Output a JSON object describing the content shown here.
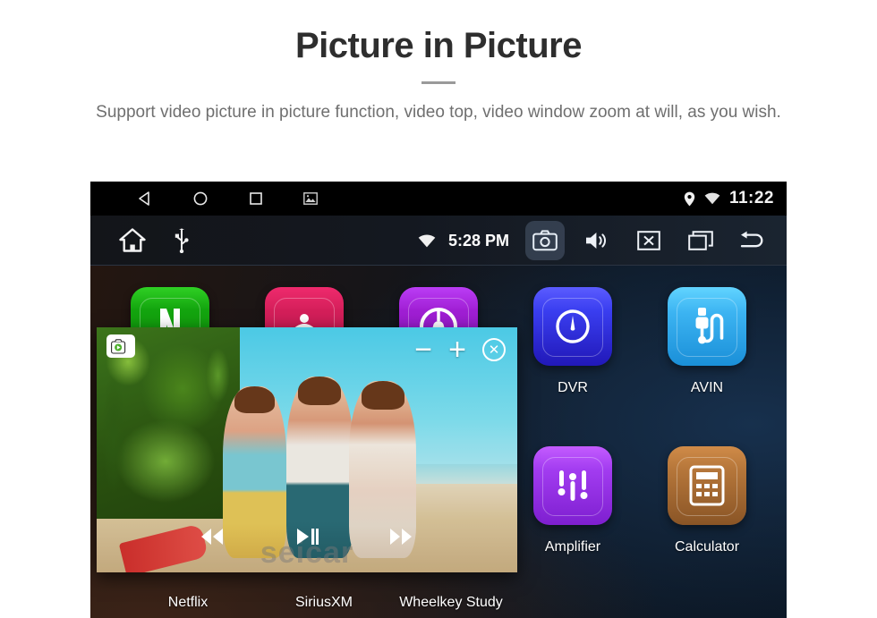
{
  "header": {
    "title": "Picture in Picture",
    "subtitle": "Support video picture in picture function, video top, video window zoom at will, as you wish."
  },
  "device": {
    "status_bar": {
      "nav_icons": [
        "back-triangle-icon",
        "home-circle-icon",
        "recents-square-icon",
        "screenshot-image-icon"
      ],
      "location_icon": "location-pin-icon",
      "wifi_icon": "wifi-icon",
      "clock": "11:22"
    },
    "system_toolbar": {
      "home_icon": "home-icon",
      "usb_icon": "usb-icon",
      "wifi_icon": "wifi-icon",
      "clock": "5:28 PM",
      "camera_icon": "camera-icon",
      "camera_active": true,
      "volume_icon": "speaker-icon",
      "close_icon": "close-box-icon",
      "recents_icon": "recent-apps-icon",
      "back_icon": "back-arrow-icon"
    },
    "wallpaper_watermark": "",
    "apps": [
      {
        "label": "Netflix",
        "icon": "netflix-icon",
        "color": "#16a810",
        "color2": "#0c8a08",
        "glyph": "netflix"
      },
      {
        "label": "SiriusXM",
        "icon": "siriusxm-icon",
        "color": "#d81f5a",
        "color2": "#b81447",
        "glyph": "sirius"
      },
      {
        "label": "Wheelkey Study",
        "icon": "wheelkey-icon",
        "color": "#a01fd4",
        "color2": "#8310b6",
        "glyph": "wheel"
      },
      {
        "label": "DVR",
        "icon": "dvr-icon",
        "color": "#3a3ef0",
        "color2": "#2520c9",
        "glyph": "gauge"
      },
      {
        "label": "AVIN",
        "icon": "avin-icon",
        "color": "#45bdf5",
        "color2": "#1f97e0",
        "glyph": "plug"
      },
      {
        "label": "Amplifier",
        "icon": "amplifier-icon",
        "color": "#a23cf0",
        "color2": "#7e1fd0",
        "glyph": "equalizer"
      },
      {
        "label": "Calculator",
        "icon": "calculator-icon",
        "color": "#b5763a",
        "color2": "#8a5526",
        "glyph": "calculator"
      }
    ],
    "pip": {
      "camera_icon": "pip-video-camera-icon",
      "zoom_out_label": "−",
      "zoom_in_label": "+",
      "close_label": "✕",
      "prev_icon": "previous-track-icon",
      "play_icon": "play-pause-icon",
      "next_icon": "next-track-icon",
      "watermark": "seicar"
    }
  }
}
